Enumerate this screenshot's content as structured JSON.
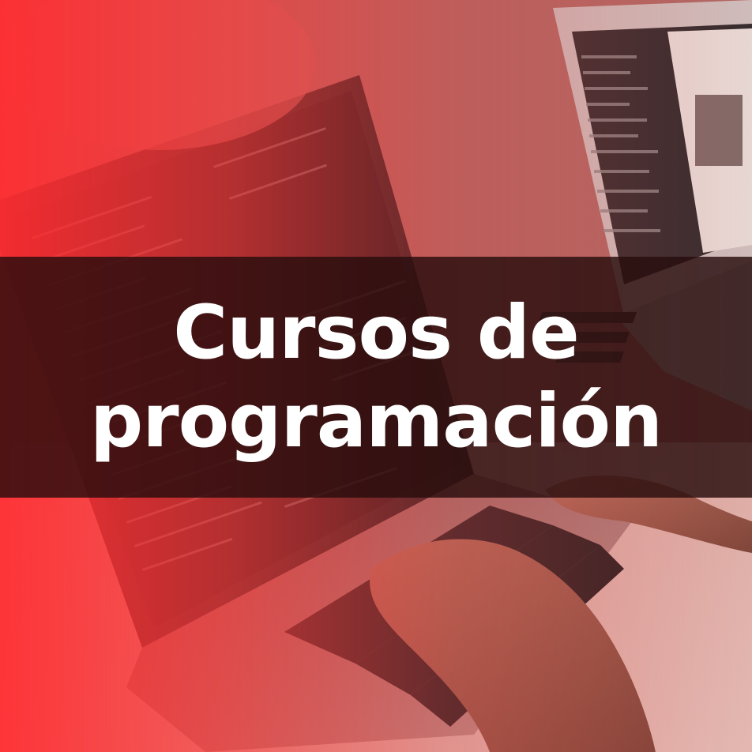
{
  "image": {
    "subject": "laptops-with-code-and-hands-typing",
    "overlay_color": "#ff2d32",
    "banner_color": "#280e0e"
  },
  "banner": {
    "line1": "Cursos de",
    "line2": "programación"
  }
}
